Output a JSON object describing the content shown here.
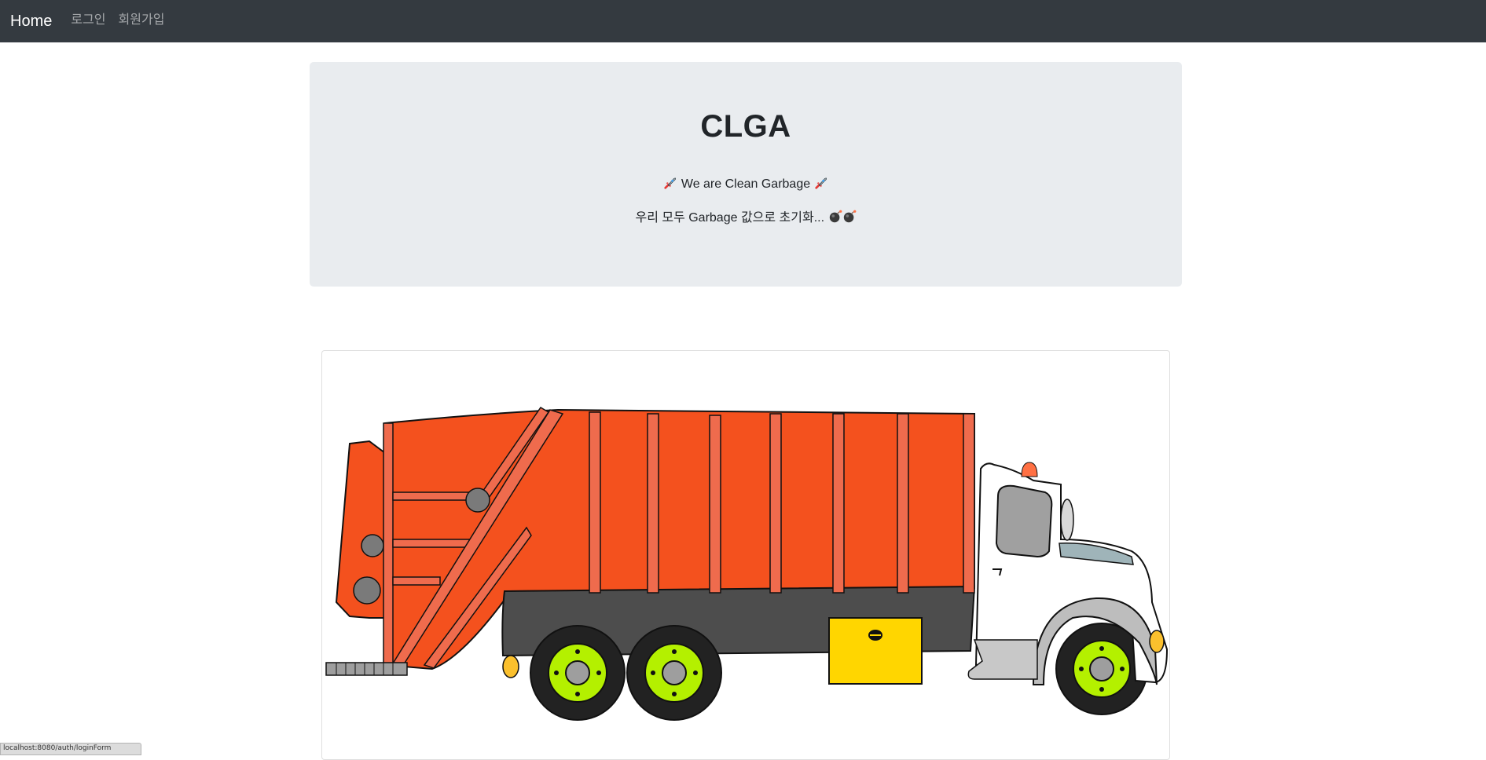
{
  "navbar": {
    "brand": "Home",
    "links": [
      "로그인",
      "회원가입"
    ]
  },
  "jumbotron": {
    "title": "CLGA",
    "line1_text": "We are Clean Garbage",
    "line2_text": "우리 모두 Garbage 값으로 초기화...",
    "line1_icons": [
      "rocket-icon",
      "rocket-icon"
    ],
    "line2_icons": [
      "bomb-icon",
      "bomb-icon"
    ]
  },
  "status_bar": {
    "url": "localhost:8080/auth/loginForm"
  },
  "colors": {
    "navbar_bg": "#343a40",
    "jumbotron_bg": "#e9ecef",
    "truck_body": "#f4511e",
    "truck_ribs": "#f06a4a",
    "truck_chassis": "#4a4a4a",
    "wheel_rim": "#b4f000",
    "fuel_box": "#ffd600",
    "cab": "#ffffff"
  }
}
